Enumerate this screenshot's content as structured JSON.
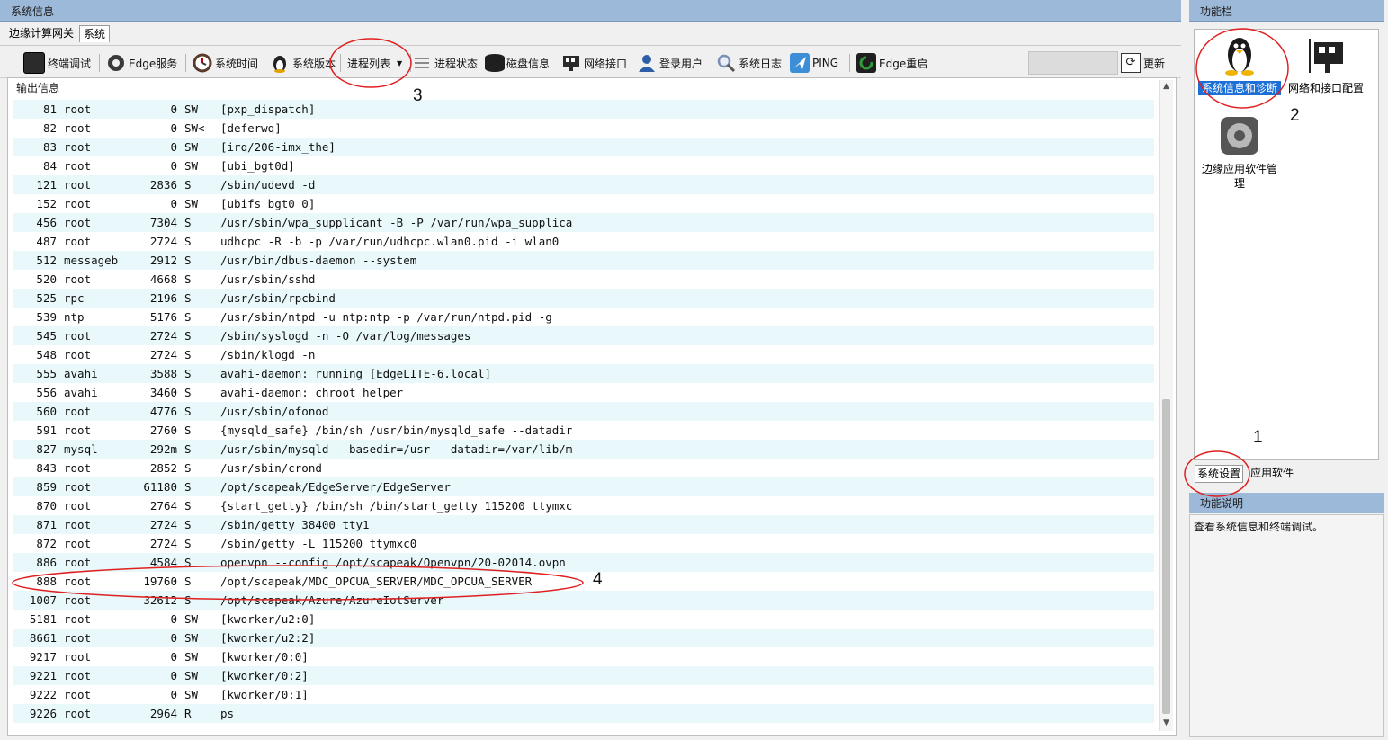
{
  "left_panel": {
    "title": "系统信息",
    "tabs": [
      {
        "label": "边缘计算网关"
      },
      {
        "label": "系统"
      }
    ]
  },
  "toolbar": {
    "items": [
      {
        "label": "终端调试",
        "icon": "terminal-icon",
        "color": "#2b2b2b"
      },
      {
        "label": "Edge服务",
        "icon": "gear-icon",
        "color": "#3a3a3a"
      },
      {
        "label": "系统时间",
        "icon": "clock-icon",
        "color": "#5a3b2a"
      },
      {
        "label": "系统版本",
        "icon": "linux-penguin-icon",
        "color": "#222222"
      },
      {
        "label": "进程列表",
        "icon": "dropdown-caret-icon",
        "color": "#f0f0f0"
      },
      {
        "label": "进程状态",
        "icon": "list-lines-icon",
        "color": "#8a8a8a"
      },
      {
        "label": "磁盘信息",
        "icon": "disk-icon",
        "color": "#1f1f1f"
      },
      {
        "label": "网络接口",
        "icon": "network-card-icon",
        "color": "#2a2a2a"
      },
      {
        "label": "登录用户",
        "icon": "user-icon",
        "color": "#2d5fa8"
      },
      {
        "label": "系统日志",
        "icon": "magnifier-icon",
        "color": "#7a8fb5"
      },
      {
        "label": "PING",
        "icon": "ping-plane-icon",
        "color": "#3c8fd6"
      },
      {
        "label": "Edge重启",
        "icon": "restart-icon",
        "color": "#2e9b3a"
      }
    ],
    "refresh_label": "更新",
    "refresh_input_value": ""
  },
  "output": {
    "label": "输出信息",
    "rows": [
      {
        "pid": "81",
        "user": "root",
        "vsz": "0",
        "stat": "SW",
        "cmd": "[pxp_dispatch]"
      },
      {
        "pid": "82",
        "user": "root",
        "vsz": "0",
        "stat": "SW<",
        "cmd": "[deferwq]"
      },
      {
        "pid": "83",
        "user": "root",
        "vsz": "0",
        "stat": "SW",
        "cmd": "[irq/206-imx_the]"
      },
      {
        "pid": "84",
        "user": "root",
        "vsz": "0",
        "stat": "SW",
        "cmd": "[ubi_bgt0d]"
      },
      {
        "pid": "121",
        "user": "root",
        "vsz": "2836",
        "stat": "S",
        "cmd": "/sbin/udevd -d"
      },
      {
        "pid": "152",
        "user": "root",
        "vsz": "0",
        "stat": "SW",
        "cmd": "[ubifs_bgt0_0]"
      },
      {
        "pid": "456",
        "user": "root",
        "vsz": "7304",
        "stat": "S",
        "cmd": "/usr/sbin/wpa_supplicant -B -P /var/run/wpa_supplica"
      },
      {
        "pid": "487",
        "user": "root",
        "vsz": "2724",
        "stat": "S",
        "cmd": "udhcpc -R -b -p /var/run/udhcpc.wlan0.pid -i wlan0"
      },
      {
        "pid": "512",
        "user": "messageb",
        "vsz": "2912",
        "stat": "S",
        "cmd": "/usr/bin/dbus-daemon --system"
      },
      {
        "pid": "520",
        "user": "root",
        "vsz": "4668",
        "stat": "S",
        "cmd": "/usr/sbin/sshd"
      },
      {
        "pid": "525",
        "user": "rpc",
        "vsz": "2196",
        "stat": "S",
        "cmd": "/usr/sbin/rpcbind"
      },
      {
        "pid": "539",
        "user": "ntp",
        "vsz": "5176",
        "stat": "S",
        "cmd": "/usr/sbin/ntpd -u ntp:ntp -p /var/run/ntpd.pid -g"
      },
      {
        "pid": "545",
        "user": "root",
        "vsz": "2724",
        "stat": "S",
        "cmd": "/sbin/syslogd -n -O /var/log/messages"
      },
      {
        "pid": "548",
        "user": "root",
        "vsz": "2724",
        "stat": "S",
        "cmd": "/sbin/klogd -n"
      },
      {
        "pid": "555",
        "user": "avahi",
        "vsz": "3588",
        "stat": "S",
        "cmd": "avahi-daemon: running [EdgeLITE-6.local]"
      },
      {
        "pid": "556",
        "user": "avahi",
        "vsz": "3460",
        "stat": "S",
        "cmd": "avahi-daemon: chroot helper"
      },
      {
        "pid": "560",
        "user": "root",
        "vsz": "4776",
        "stat": "S",
        "cmd": "/usr/sbin/ofonod"
      },
      {
        "pid": "591",
        "user": "root",
        "vsz": "2760",
        "stat": "S",
        "cmd": "{mysqld_safe} /bin/sh /usr/bin/mysqld_safe --datadir"
      },
      {
        "pid": "827",
        "user": "mysql",
        "vsz": "292m",
        "stat": "S",
        "cmd": "/usr/sbin/mysqld --basedir=/usr --datadir=/var/lib/m"
      },
      {
        "pid": "843",
        "user": "root",
        "vsz": "2852",
        "stat": "S",
        "cmd": "/usr/sbin/crond"
      },
      {
        "pid": "859",
        "user": "root",
        "vsz": "61180",
        "stat": "S",
        "cmd": "/opt/scapeak/EdgeServer/EdgeServer"
      },
      {
        "pid": "870",
        "user": "root",
        "vsz": "2764",
        "stat": "S",
        "cmd": "{start_getty} /bin/sh /bin/start_getty 115200 ttymxc"
      },
      {
        "pid": "871",
        "user": "root",
        "vsz": "2724",
        "stat": "S",
        "cmd": "/sbin/getty 38400 tty1"
      },
      {
        "pid": "872",
        "user": "root",
        "vsz": "2724",
        "stat": "S",
        "cmd": "/sbin/getty -L 115200 ttymxc0"
      },
      {
        "pid": "886",
        "user": "root",
        "vsz": "4584",
        "stat": "S",
        "cmd": "openvpn --config /opt/scapeak/Openvpn/20-02014.ovpn"
      },
      {
        "pid": "888",
        "user": "root",
        "vsz": "19760",
        "stat": "S",
        "cmd": "/opt/scapeak/MDC_OPCUA_SERVER/MDC_OPCUA_SERVER"
      },
      {
        "pid": "1007",
        "user": "root",
        "vsz": "32612",
        "stat": "S",
        "cmd": "/opt/scapeak/Azure/AzureIotServer"
      },
      {
        "pid": "5181",
        "user": "root",
        "vsz": "0",
        "stat": "SW",
        "cmd": "[kworker/u2:0]"
      },
      {
        "pid": "8661",
        "user": "root",
        "vsz": "0",
        "stat": "SW",
        "cmd": "[kworker/u2:2]"
      },
      {
        "pid": "9217",
        "user": "root",
        "vsz": "0",
        "stat": "SW",
        "cmd": "[kworker/0:0]"
      },
      {
        "pid": "9221",
        "user": "root",
        "vsz": "0",
        "stat": "SW",
        "cmd": "[kworker/0:2]"
      },
      {
        "pid": "9222",
        "user": "root",
        "vsz": "0",
        "stat": "SW",
        "cmd": "[kworker/0:1]"
      },
      {
        "pid": "9226",
        "user": "root",
        "vsz": "2964",
        "stat": "R",
        "cmd": "ps"
      }
    ]
  },
  "right_panel": {
    "title": "功能栏",
    "functions": [
      {
        "label": "系统信息和诊断",
        "icon": "linux-penguin-icon",
        "selected": true
      },
      {
        "label": "网络和接口配置",
        "icon": "network-card-icon",
        "selected": false
      },
      {
        "label": "边缘应用软件管理",
        "icon": "settings-gear-icon",
        "selected": false
      }
    ],
    "bottom_tabs": [
      {
        "label": "系统设置"
      },
      {
        "label": "应用软件"
      }
    ],
    "desc_title": "功能说明",
    "desc_text": "查看系统信息和终端调试。"
  },
  "annotations": {
    "numbers": [
      "1",
      "2",
      "3",
      "4"
    ],
    "color": "#e02020"
  }
}
